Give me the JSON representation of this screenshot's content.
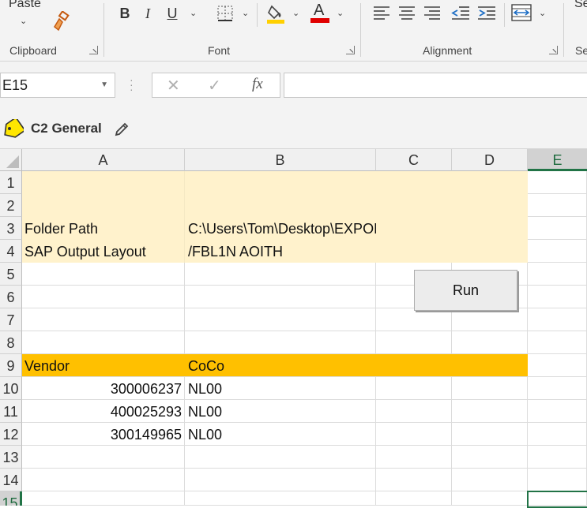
{
  "ribbon": {
    "paste_label": "Paste",
    "groups": {
      "clipboard": "Clipboard",
      "font": "Font",
      "alignment": "Alignment",
      "next_partial": "Se",
      "next_partial_label": "Se"
    },
    "font_buttons": {
      "bold": "B",
      "italic": "I",
      "underline": "U",
      "font_color_letter": "A"
    },
    "fill_color": "#ffd000",
    "font_color": "#e00000"
  },
  "formula_bar": {
    "name_box": "E15",
    "cancel_glyph": "✕",
    "enter_glyph": "✓",
    "fx_glyph": "fx",
    "value": ""
  },
  "label_bar": {
    "label": "C2 General"
  },
  "sheet": {
    "columns": [
      "A",
      "B",
      "C",
      "D",
      "E"
    ],
    "rows": [
      "1",
      "2",
      "3",
      "4",
      "5",
      "6",
      "7",
      "8",
      "9",
      "10",
      "11",
      "12",
      "13",
      "14",
      "15"
    ],
    "selected_column": "E",
    "cells": {
      "A3": "Folder Path",
      "B3": "C:\\Users\\Tom\\Desktop\\EXPORT DOCUMENTS",
      "A4": "SAP Output Layout",
      "B4": "/FBL1N AOITH",
      "A9": "Vendor",
      "B9": "CoCo",
      "A10": "300006237",
      "B10": "NL00",
      "A11": "400025293",
      "B11": "NL00",
      "A12": "300149965",
      "B12": "NL00"
    },
    "colors": {
      "beige": "#fff2cc",
      "orange": "#ffc000",
      "selection": "#217346"
    }
  },
  "run_button": {
    "label": "Run"
  }
}
